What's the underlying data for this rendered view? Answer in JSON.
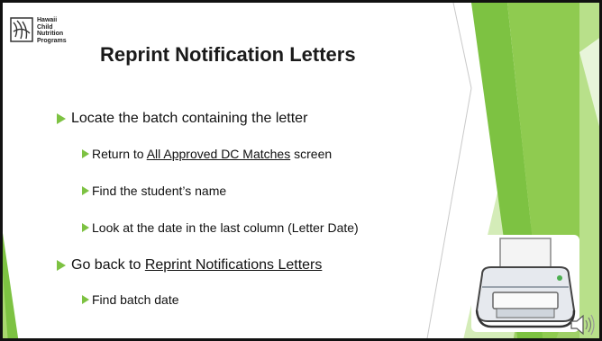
{
  "logo": {
    "lines": [
      "Hawaii",
      "Child",
      "Nutrition",
      "Programs"
    ],
    "icon": "hawaii-child-nutrition-logo"
  },
  "title": "Reprint Notification Letters",
  "bullets": {
    "b1": "Locate the batch containing the letter",
    "b1_1": {
      "prefix": "Return to ",
      "link": "All Approved DC Matches",
      "suffix": " screen"
    },
    "b1_2": "Find the student’s name",
    "b1_3": "Look at the date in the last column (Letter Date)",
    "b2": {
      "prefix": "Go back to ",
      "link": "Reprint Notifications Letters"
    },
    "b2_1": "Find batch date"
  },
  "graphics": {
    "printer_icon": "printer-icon",
    "speaker_icon": "audio-speaker-icon"
  },
  "colors": {
    "accent_green": "#7dc242",
    "light_green": "#c6e5a4"
  }
}
